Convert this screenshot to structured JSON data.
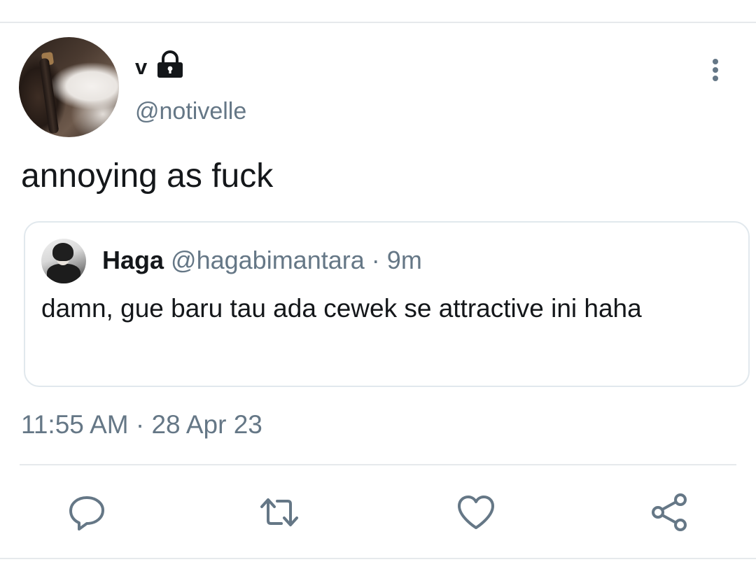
{
  "tweet": {
    "author": {
      "display_name": "v",
      "username": "@notivelle",
      "protected_icon": "lock-icon"
    },
    "text": "annoying as fuck",
    "timestamp": "11:55 AM · 28 Apr 23"
  },
  "quoted_tweet": {
    "display_name": "Haga",
    "username": "@hagabimantara",
    "separator": "·",
    "time_ago": "9m",
    "text": "damn, gue baru tau ada cewek se attractive ini haha"
  },
  "actions": [
    {
      "name": "reply",
      "icon": "reply-icon"
    },
    {
      "name": "retweet",
      "icon": "retweet-icon"
    },
    {
      "name": "like",
      "icon": "like-icon"
    },
    {
      "name": "share",
      "icon": "share-icon"
    }
  ],
  "colors": {
    "text_primary": "#14171a",
    "text_secondary": "#657786",
    "divider": "#e6e9ec",
    "icon": "#657786"
  }
}
